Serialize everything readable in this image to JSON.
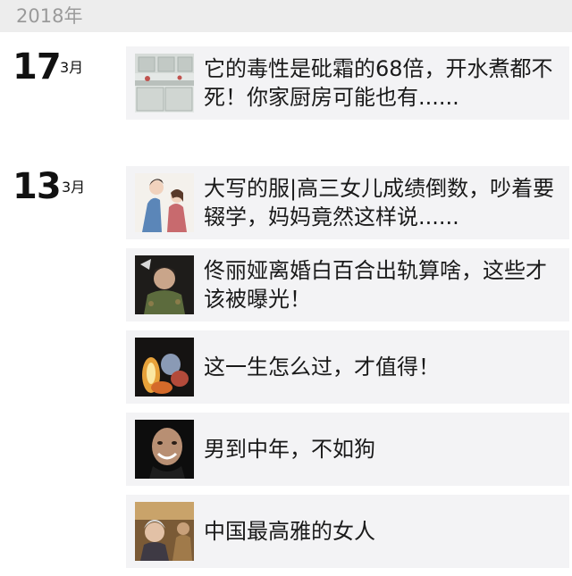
{
  "year_label": "2018年",
  "groups": [
    {
      "day": "17",
      "month": "3月",
      "items": [
        {
          "title": "它的毒性是砒霜的68倍，开水煮都不死！你家厨房可能也有......",
          "thumb_icon": "kitchen-photo-icon"
        }
      ]
    },
    {
      "day": "13",
      "month": "3月",
      "items": [
        {
          "title": "大写的服|高三女儿成绩倒数，吵着要辍学，妈妈竟然这样说......",
          "thumb_icon": "mother-daughter-illustration-icon"
        },
        {
          "title": "佟丽娅离婚白百合出轨算啥，这些才该被曝光！",
          "thumb_icon": "man-in-uniform-photo-icon"
        },
        {
          "title": "这一生怎么过，才值得！",
          "thumb_icon": "glowing-flowers-photo-icon"
        },
        {
          "title": "男到中年，不如狗",
          "thumb_icon": "smiling-man-photo-icon"
        },
        {
          "title": "中国最高雅的女人",
          "thumb_icon": "elderly-woman-photo-icon"
        }
      ]
    }
  ],
  "colors": {
    "header_bg": "#ededed",
    "card_bg": "#f3f3f5",
    "year_text": "#9a9a9a",
    "text": "#1a1a1a"
  }
}
